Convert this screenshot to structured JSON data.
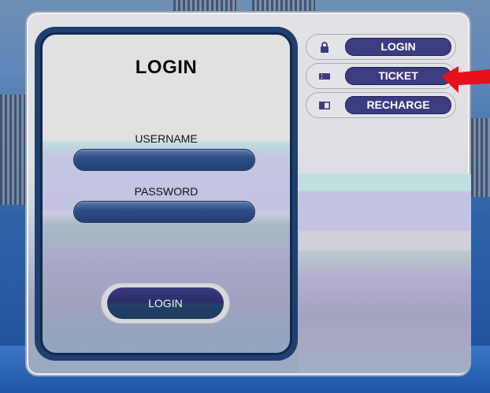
{
  "login_panel": {
    "title": "LOGIN",
    "username_label": "USERNAME",
    "username_value": "",
    "password_label": "PASSWORD",
    "password_value": "",
    "submit_label": "LOGIN"
  },
  "nav": {
    "items": [
      {
        "label": "LOGIN",
        "icon": "lock-icon"
      },
      {
        "label": "TICKET",
        "icon": "ticket-icon"
      },
      {
        "label": "RECHARGE",
        "icon": "card-icon"
      }
    ]
  },
  "annotation": {
    "arrow_color": "#e8101a",
    "points_to": "TICKET"
  },
  "colors": {
    "nav_label_bg": "#3c3c80",
    "input_bg": "#2e4f86",
    "card_border": "#1f3f6e"
  }
}
